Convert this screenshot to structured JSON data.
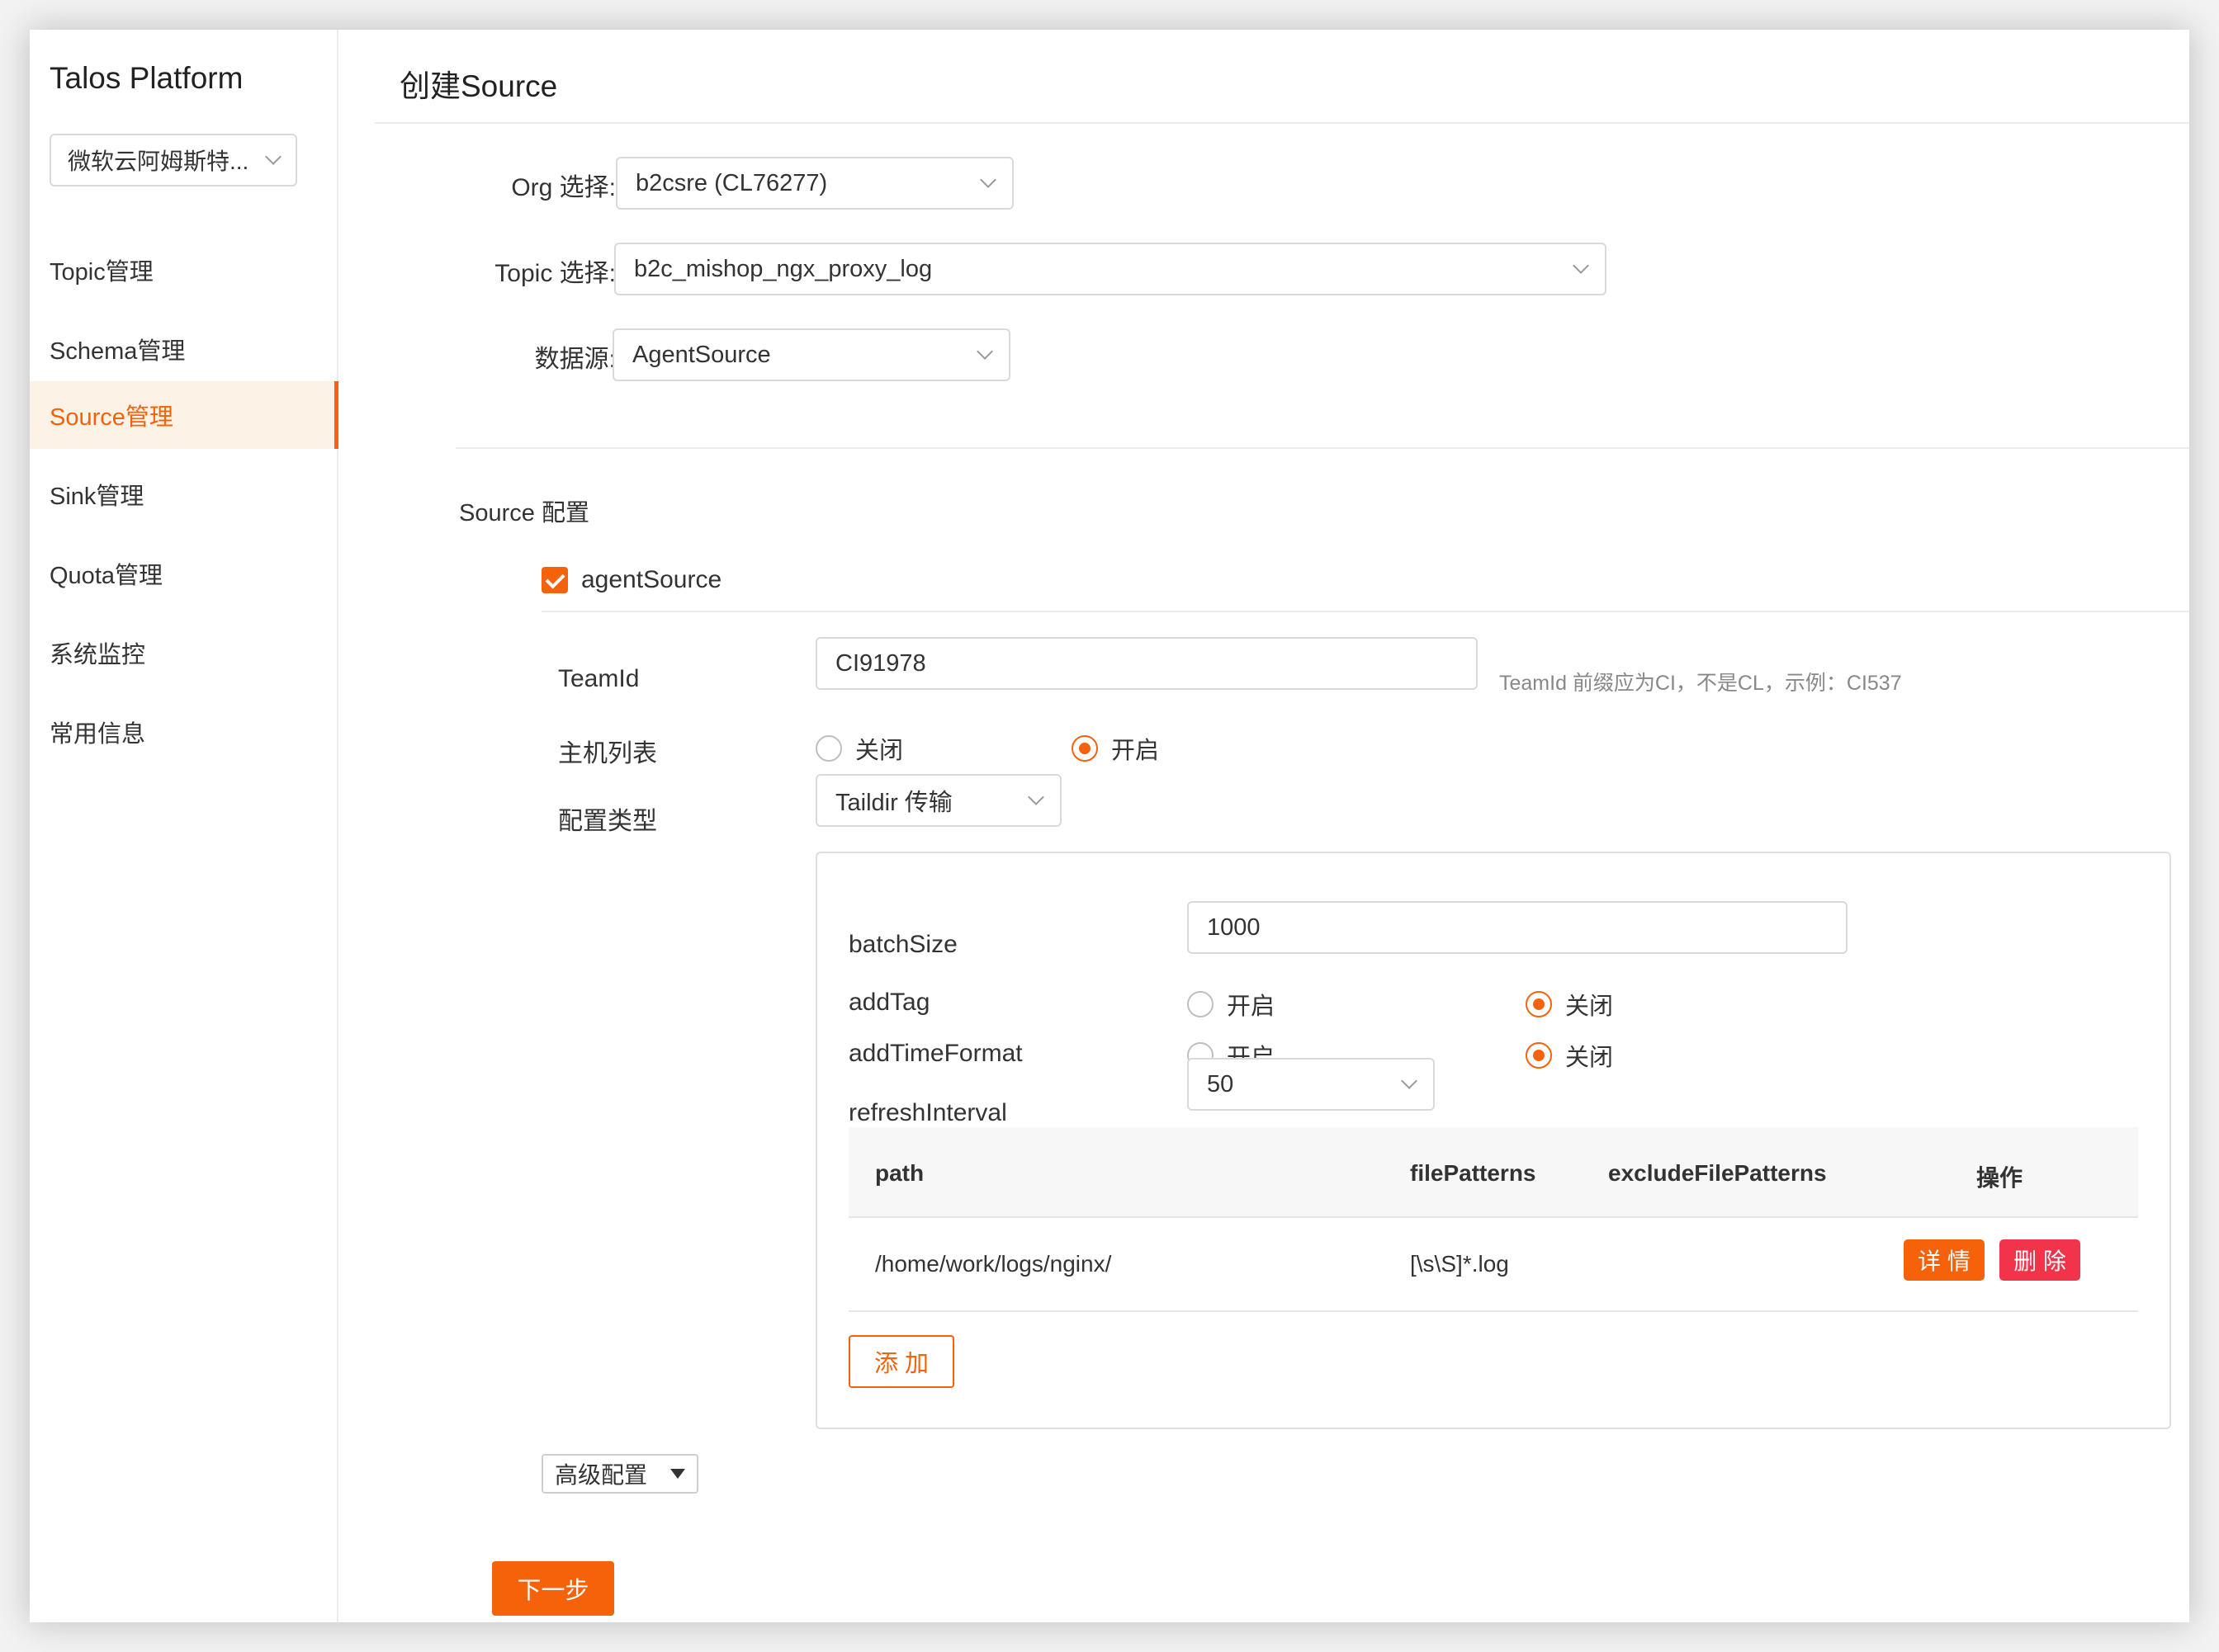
{
  "sidebar": {
    "brand": "Talos Platform",
    "cluster": "微软云阿姆斯特...",
    "items": [
      {
        "label": "Topic管理"
      },
      {
        "label": "Schema管理"
      },
      {
        "label": "Source管理"
      },
      {
        "label": "Sink管理"
      },
      {
        "label": "Quota管理"
      },
      {
        "label": "系统监控"
      },
      {
        "label": "常用信息"
      }
    ],
    "active_index": 2
  },
  "page": {
    "title": "创建Source",
    "org_label": "Org 选择:",
    "org_value": "b2csre (CL76277)",
    "topic_label": "Topic 选择:",
    "topic_value": "b2c_mishop_ngx_proxy_log",
    "datasource_label": "数据源:",
    "datasource_value": "AgentSource"
  },
  "source_config": {
    "section_title": "Source 配置",
    "checkbox_label": "agentSource",
    "checkbox_checked": true,
    "teamid_label": "TeamId",
    "teamid_value": "CI91978",
    "teamid_hint": "TeamId 前缀应为CI，不是CL，示例：CI537",
    "hostlist_label": "主机列表",
    "hostlist_off": "关闭",
    "hostlist_on": "开启",
    "hostlist_selected": "on",
    "config_type_label": "配置类型",
    "config_type_value": "Taildir 传输"
  },
  "taildir": {
    "batchsize_label": "batchSize",
    "batchsize_value": "1000",
    "addtag_label": "addTag",
    "addtag_on": "开启",
    "addtag_off": "关闭",
    "addtag_selected": "off",
    "addtimeformat_label": "addTimeFormat",
    "addtimeformat_on": "开启",
    "addtimeformat_off": "关闭",
    "addtimeformat_selected": "off",
    "refresh_label": "refreshInterval",
    "refresh_value": "50",
    "table": {
      "columns": [
        "path",
        "filePatterns",
        "excludeFilePatterns",
        "操作"
      ],
      "rows": [
        {
          "path": "/home/work/logs/nginx/",
          "filePatterns": "[\\s\\S]*.log",
          "excludeFilePatterns": ""
        }
      ],
      "detail_label": "详 情",
      "delete_label": "删 除"
    },
    "add_label": "添 加"
  },
  "advanced_label": "高级配置",
  "next_label": "下一步",
  "colors": {
    "accent": "#f5620a",
    "danger": "#f2344a",
    "active_bg": "#fdf2e6"
  }
}
